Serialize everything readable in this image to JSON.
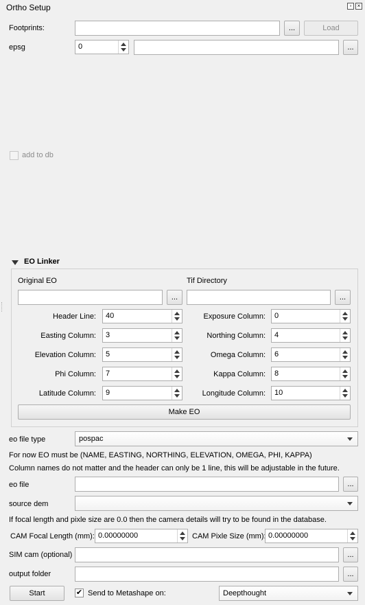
{
  "window": {
    "title": "Ortho Setup"
  },
  "top": {
    "footprints_label": "Footprints:",
    "footprints_value": "",
    "browse_label": "...",
    "load_label": "Load",
    "epsg_label": "epsg",
    "epsg_value": "0",
    "epsg_text": "",
    "epsg_browse_label": "...",
    "add_to_db_label": "add to db"
  },
  "eo_linker": {
    "title": "EO Linker",
    "original_eo_label": "Original EO",
    "original_eo_value": "",
    "tif_directory_label": "Tif Directory",
    "tif_directory_value": "",
    "browse_label": "...",
    "fields": {
      "header_line": {
        "label": "Header Line:",
        "value": "40"
      },
      "exposure_column": {
        "label": "Exposure Column:",
        "value": "0"
      },
      "easting_column": {
        "label": "Easting Column:",
        "value": "3"
      },
      "northing_column": {
        "label": "Northing Column:",
        "value": "4"
      },
      "elevation_column": {
        "label": "Elevation Column:",
        "value": "5"
      },
      "omega_column": {
        "label": "Omega Column:",
        "value": "6"
      },
      "phi_column": {
        "label": "Phi Column:",
        "value": "7"
      },
      "kappa_column": {
        "label": "Kappa Column:",
        "value": "8"
      },
      "latitude_column": {
        "label": "Latitude Column:",
        "value": "9"
      },
      "longitude_column": {
        "label": "Longitude Column:",
        "value": "10"
      }
    },
    "make_eo_label": "Make EO"
  },
  "bottom": {
    "eo_file_type_label": "eo file type",
    "eo_file_type_value": "pospac",
    "info_line1": "For now EO must be (NAME,  EASTING, NORTHING, ELEVATION, OMEGA, PHI, KAPPA)",
    "info_line2": "Column names do not matter and the header can only be 1 line, this will be adjustable in the future.",
    "eo_file_label": "eo file",
    "eo_file_value": "",
    "source_dem_label": "source dem",
    "source_dem_value": "",
    "info_line3": "If focal length and pixle size are 0.0 then the camera details will try to be found in the database.",
    "cam_focal_label": "CAM Focal Length (mm):",
    "cam_focal_value": "0.00000000",
    "cam_pixel_label": "CAM Pixle Size (mm):",
    "cam_pixel_value": "0.00000000",
    "sim_cam_label": "SIM cam (optional)",
    "sim_cam_value": "",
    "output_folder_label": "output  folder",
    "output_folder_value": "",
    "browse_label": "...",
    "start_label": "Start",
    "send_to_label": "Send to Metashape on:",
    "send_to_checked": "✔",
    "server_value": "Deepthought"
  }
}
